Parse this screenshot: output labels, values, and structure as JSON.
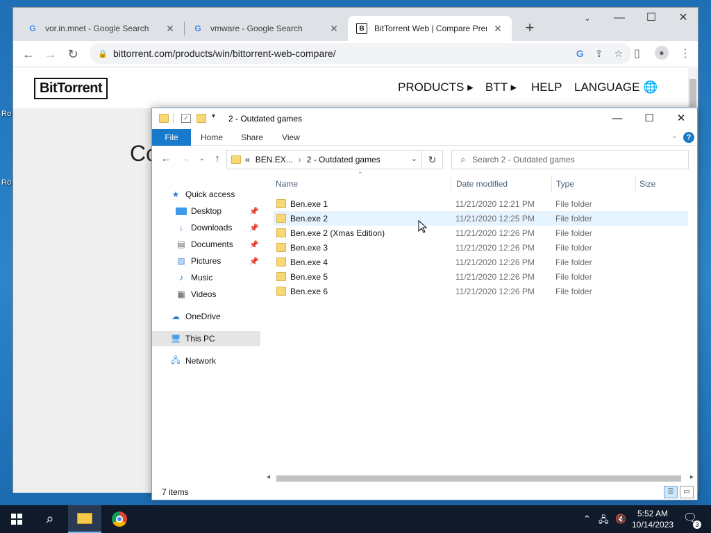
{
  "desktop": {
    "icon_labels": [
      "Ro",
      "Ro"
    ]
  },
  "chrome": {
    "tabs": [
      {
        "title": "vor.in.mnet - Google Search",
        "favicon": "google-g-icon"
      },
      {
        "title": "vmware - Google Search",
        "favicon": "google-g-icon"
      },
      {
        "title": "BitTorrent Web | Compare Prem",
        "favicon": "bittorrent-b-icon"
      }
    ],
    "url": "bittorrent.com/products/win/bittorrent-web-compare/",
    "close_glyph": "✕",
    "newtab_glyph": "+"
  },
  "site": {
    "logo": "BitTorrent",
    "nav": [
      "PRODUCTS ▸",
      "BTT ▸",
      "HELP",
      "LANGUAGE"
    ],
    "big_text": "Co"
  },
  "explorer": {
    "title": "2 - Outdated games",
    "ribbon_tabs": [
      "File",
      "Home",
      "Share",
      "View"
    ],
    "breadcrumb": {
      "overflow": "«",
      "items": [
        "BEN.EX...",
        "2 - Outdated games"
      ],
      "separator": "›"
    },
    "search_placeholder": "Search 2 - Outdated games",
    "nav_pane": [
      {
        "label": "Quick access",
        "icon": "star-icon"
      },
      {
        "label": "Desktop",
        "icon": "desktop-icon",
        "pinned": true
      },
      {
        "label": "Downloads",
        "icon": "downloads-icon",
        "pinned": true
      },
      {
        "label": "Documents",
        "icon": "documents-icon",
        "pinned": true
      },
      {
        "label": "Pictures",
        "icon": "pictures-icon",
        "pinned": true
      },
      {
        "label": "Music",
        "icon": "music-icon"
      },
      {
        "label": "Videos",
        "icon": "videos-icon"
      },
      {
        "label": "OneDrive",
        "icon": "cloud-icon"
      },
      {
        "label": "This PC",
        "icon": "computer-icon",
        "selected": true
      },
      {
        "label": "Network",
        "icon": "network-icon"
      }
    ],
    "columns": [
      "Name",
      "Date modified",
      "Type",
      "Size"
    ],
    "files": [
      {
        "name": "Ben.exe 1",
        "date": "11/21/2020 12:21 PM",
        "type": "File folder"
      },
      {
        "name": "Ben.exe 2",
        "date": "11/21/2020 12:25 PM",
        "type": "File folder",
        "hover": true
      },
      {
        "name": "Ben.exe 2 (Xmas Edition)",
        "date": "11/21/2020 12:26 PM",
        "type": "File folder"
      },
      {
        "name": "Ben.exe 3",
        "date": "11/21/2020 12:26 PM",
        "type": "File folder"
      },
      {
        "name": "Ben.exe 4",
        "date": "11/21/2020 12:26 PM",
        "type": "File folder"
      },
      {
        "name": "Ben.exe 5",
        "date": "11/21/2020 12:26 PM",
        "type": "File folder"
      },
      {
        "name": "Ben.exe 6",
        "date": "11/21/2020 12:26 PM",
        "type": "File folder"
      }
    ],
    "status": "7 items"
  },
  "taskbar": {
    "time": "5:52 AM",
    "date": "10/14/2023",
    "notification_count": "3"
  },
  "colors": {
    "accent": "#1979ca",
    "folder": "#f8d775",
    "taskbar": "#101a2a"
  }
}
